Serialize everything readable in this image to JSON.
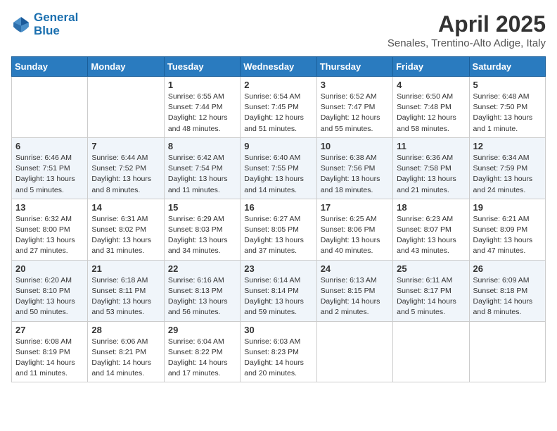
{
  "logo": {
    "line1": "General",
    "line2": "Blue"
  },
  "title": "April 2025",
  "subtitle": "Senales, Trentino-Alto Adige, Italy",
  "weekdays": [
    "Sunday",
    "Monday",
    "Tuesday",
    "Wednesday",
    "Thursday",
    "Friday",
    "Saturday"
  ],
  "weeks": [
    [
      {
        "day": "",
        "info": ""
      },
      {
        "day": "",
        "info": ""
      },
      {
        "day": "1",
        "info": "Sunrise: 6:55 AM\nSunset: 7:44 PM\nDaylight: 12 hours\nand 48 minutes."
      },
      {
        "day": "2",
        "info": "Sunrise: 6:54 AM\nSunset: 7:45 PM\nDaylight: 12 hours\nand 51 minutes."
      },
      {
        "day": "3",
        "info": "Sunrise: 6:52 AM\nSunset: 7:47 PM\nDaylight: 12 hours\nand 55 minutes."
      },
      {
        "day": "4",
        "info": "Sunrise: 6:50 AM\nSunset: 7:48 PM\nDaylight: 12 hours\nand 58 minutes."
      },
      {
        "day": "5",
        "info": "Sunrise: 6:48 AM\nSunset: 7:50 PM\nDaylight: 13 hours\nand 1 minute."
      }
    ],
    [
      {
        "day": "6",
        "info": "Sunrise: 6:46 AM\nSunset: 7:51 PM\nDaylight: 13 hours\nand 5 minutes."
      },
      {
        "day": "7",
        "info": "Sunrise: 6:44 AM\nSunset: 7:52 PM\nDaylight: 13 hours\nand 8 minutes."
      },
      {
        "day": "8",
        "info": "Sunrise: 6:42 AM\nSunset: 7:54 PM\nDaylight: 13 hours\nand 11 minutes."
      },
      {
        "day": "9",
        "info": "Sunrise: 6:40 AM\nSunset: 7:55 PM\nDaylight: 13 hours\nand 14 minutes."
      },
      {
        "day": "10",
        "info": "Sunrise: 6:38 AM\nSunset: 7:56 PM\nDaylight: 13 hours\nand 18 minutes."
      },
      {
        "day": "11",
        "info": "Sunrise: 6:36 AM\nSunset: 7:58 PM\nDaylight: 13 hours\nand 21 minutes."
      },
      {
        "day": "12",
        "info": "Sunrise: 6:34 AM\nSunset: 7:59 PM\nDaylight: 13 hours\nand 24 minutes."
      }
    ],
    [
      {
        "day": "13",
        "info": "Sunrise: 6:32 AM\nSunset: 8:00 PM\nDaylight: 13 hours\nand 27 minutes."
      },
      {
        "day": "14",
        "info": "Sunrise: 6:31 AM\nSunset: 8:02 PM\nDaylight: 13 hours\nand 31 minutes."
      },
      {
        "day": "15",
        "info": "Sunrise: 6:29 AM\nSunset: 8:03 PM\nDaylight: 13 hours\nand 34 minutes."
      },
      {
        "day": "16",
        "info": "Sunrise: 6:27 AM\nSunset: 8:05 PM\nDaylight: 13 hours\nand 37 minutes."
      },
      {
        "day": "17",
        "info": "Sunrise: 6:25 AM\nSunset: 8:06 PM\nDaylight: 13 hours\nand 40 minutes."
      },
      {
        "day": "18",
        "info": "Sunrise: 6:23 AM\nSunset: 8:07 PM\nDaylight: 13 hours\nand 43 minutes."
      },
      {
        "day": "19",
        "info": "Sunrise: 6:21 AM\nSunset: 8:09 PM\nDaylight: 13 hours\nand 47 minutes."
      }
    ],
    [
      {
        "day": "20",
        "info": "Sunrise: 6:20 AM\nSunset: 8:10 PM\nDaylight: 13 hours\nand 50 minutes."
      },
      {
        "day": "21",
        "info": "Sunrise: 6:18 AM\nSunset: 8:11 PM\nDaylight: 13 hours\nand 53 minutes."
      },
      {
        "day": "22",
        "info": "Sunrise: 6:16 AM\nSunset: 8:13 PM\nDaylight: 13 hours\nand 56 minutes."
      },
      {
        "day": "23",
        "info": "Sunrise: 6:14 AM\nSunset: 8:14 PM\nDaylight: 13 hours\nand 59 minutes."
      },
      {
        "day": "24",
        "info": "Sunrise: 6:13 AM\nSunset: 8:15 PM\nDaylight: 14 hours\nand 2 minutes."
      },
      {
        "day": "25",
        "info": "Sunrise: 6:11 AM\nSunset: 8:17 PM\nDaylight: 14 hours\nand 5 minutes."
      },
      {
        "day": "26",
        "info": "Sunrise: 6:09 AM\nSunset: 8:18 PM\nDaylight: 14 hours\nand 8 minutes."
      }
    ],
    [
      {
        "day": "27",
        "info": "Sunrise: 6:08 AM\nSunset: 8:19 PM\nDaylight: 14 hours\nand 11 minutes."
      },
      {
        "day": "28",
        "info": "Sunrise: 6:06 AM\nSunset: 8:21 PM\nDaylight: 14 hours\nand 14 minutes."
      },
      {
        "day": "29",
        "info": "Sunrise: 6:04 AM\nSunset: 8:22 PM\nDaylight: 14 hours\nand 17 minutes."
      },
      {
        "day": "30",
        "info": "Sunrise: 6:03 AM\nSunset: 8:23 PM\nDaylight: 14 hours\nand 20 minutes."
      },
      {
        "day": "",
        "info": ""
      },
      {
        "day": "",
        "info": ""
      },
      {
        "day": "",
        "info": ""
      }
    ]
  ]
}
